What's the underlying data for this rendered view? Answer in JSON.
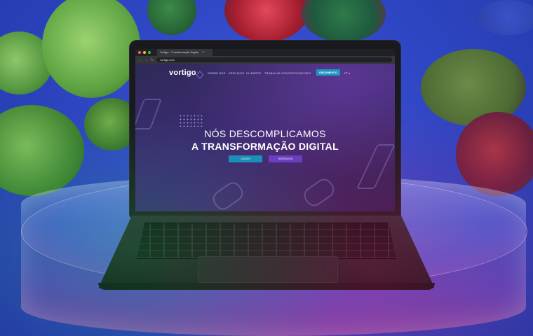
{
  "browser": {
    "tab_title": "Vortigo - Transformação Digital",
    "tab_close": "×",
    "address": "vortigo.com",
    "nav_glyphs": {
      "back": "←",
      "forward": "→",
      "reload": "↻",
      "lock": "🔒"
    }
  },
  "site": {
    "logo": "vortigo",
    "nav": [
      "SOBRE NÓS",
      "SERVIÇOS",
      "CLIENTES",
      "TRABALHE CONOSCO",
      "CONTATO"
    ],
    "cta": "ORÇAMENTO",
    "language": "PT ▾",
    "headline_line1": "NÓS DESCOMPLICAMOS",
    "headline_line2": "A TRANSFORMAÇÃO DIGITAL",
    "buttons": {
      "cases": "CASES",
      "services": "SERVIÇOS"
    }
  },
  "colors": {
    "background": "#2f46c4",
    "site_bg": "#3b2a6a",
    "cta": "#1d97c4",
    "cases_button": "#1a8fb8",
    "services_button": "#6b3fc0",
    "leaf_green": "#4f9a3d",
    "leaf_red": "#c0283a"
  }
}
